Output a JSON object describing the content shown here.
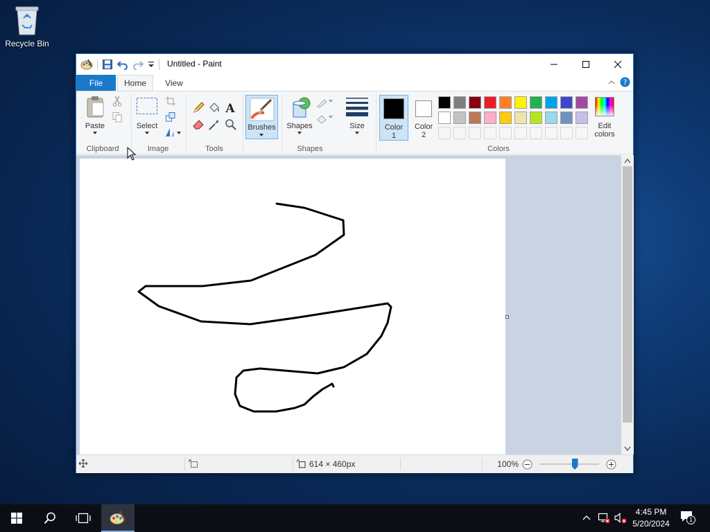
{
  "desktop": {
    "recycle_bin_label": "Recycle Bin"
  },
  "window": {
    "title": "Untitled - Paint",
    "tabs": {
      "file": "File",
      "home": "Home",
      "view": "View"
    }
  },
  "ribbon": {
    "clipboard": {
      "paste": "Paste",
      "group": "Clipboard"
    },
    "image": {
      "select": "Select",
      "group": "Image"
    },
    "tools": {
      "group": "Tools"
    },
    "brushes": {
      "label": "Brushes"
    },
    "shapes": {
      "label": "Shapes",
      "group": "Shapes"
    },
    "size": {
      "label": "Size"
    },
    "colors": {
      "color1_line1": "Color",
      "color1_line2": "1",
      "color2_line1": "Color",
      "color2_line2": "2",
      "edit_line1": "Edit",
      "edit_line2": "colors",
      "group": "Colors",
      "color1_value": "#000000",
      "color2_value": "#ffffff",
      "palette_row1": [
        "#000000",
        "#7f7f7f",
        "#880015",
        "#ed1c24",
        "#ff7f27",
        "#fff200",
        "#22b14c",
        "#00a2e8",
        "#3f48cc",
        "#a349a4"
      ],
      "palette_row2": [
        "#ffffff",
        "#c3c3c3",
        "#b97a57",
        "#ffaec9",
        "#ffc90e",
        "#efe4b0",
        "#b5e61d",
        "#99d9ea",
        "#7092be",
        "#c8bfe7"
      ]
    }
  },
  "status": {
    "size": "614 × 460px",
    "zoom": "100%",
    "zoom_level": 1.0
  },
  "taskbar": {
    "time": "4:45 PM",
    "date": "5/20/2024",
    "notifications_count": "1"
  },
  "accent": "#1979ca"
}
